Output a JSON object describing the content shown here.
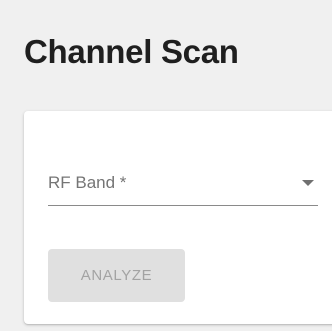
{
  "page": {
    "title": "Channel Scan"
  },
  "form": {
    "rf_band": {
      "label": "RF Band *",
      "value": ""
    },
    "analyze_button": {
      "label": "ANALYZE",
      "disabled": true
    }
  },
  "colors": {
    "page_background": "#f0f0f0",
    "card_background": "#ffffff",
    "title_text": "#1f1f1f",
    "label_text": "#757575",
    "button_disabled_bg": "#e0e0e0",
    "button_disabled_text": "#a3a3a3"
  },
  "icons": {
    "select_arrow": "chevron-down-icon"
  }
}
